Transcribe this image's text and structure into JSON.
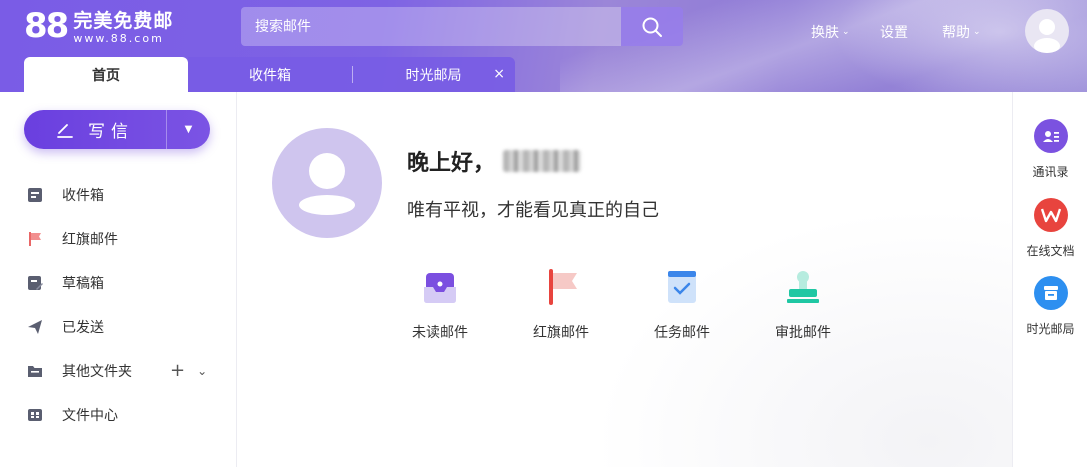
{
  "brand": {
    "logo_number": "88",
    "name": "完美免费邮",
    "url": "www.88.com"
  },
  "search": {
    "placeholder": "搜索邮件"
  },
  "header_nav": {
    "skin_label": "换肤",
    "settings_label": "设置",
    "help_label": "帮助"
  },
  "tabs": [
    {
      "label": "首页",
      "active": true
    },
    {
      "label": "收件箱",
      "active": false
    },
    {
      "label": "时光邮局",
      "active": false,
      "closable": true,
      "close_symbol": "×"
    }
  ],
  "sidebar": {
    "compose_label": "写信",
    "items": [
      {
        "label": "收件箱",
        "icon": "inbox-icon"
      },
      {
        "label": "红旗邮件",
        "icon": "red-flag-icon"
      },
      {
        "label": "草稿箱",
        "icon": "draft-icon"
      },
      {
        "label": "已发送",
        "icon": "send-icon"
      },
      {
        "label": "其他文件夹",
        "icon": "folder-icon"
      },
      {
        "label": "文件中心",
        "icon": "file-center-icon"
      }
    ],
    "folder_add_symbol": "+"
  },
  "main": {
    "greeting": "晚上好，",
    "motto": "唯有平视，才能看见真正的自己",
    "quick_actions": [
      {
        "label": "未读邮件",
        "icon": "unread-mail-icon"
      },
      {
        "label": "红旗邮件",
        "icon": "red-flag-mail-icon"
      },
      {
        "label": "任务邮件",
        "icon": "task-mail-icon"
      },
      {
        "label": "审批邮件",
        "icon": "approval-mail-icon"
      }
    ]
  },
  "right_bar": [
    {
      "label": "通讯录",
      "icon": "contacts-icon",
      "color": "#7b52e0"
    },
    {
      "label": "在线文档",
      "icon": "wps-docs-icon",
      "color": "#e8443e"
    },
    {
      "label": "时光邮局",
      "icon": "time-post-icon",
      "color": "#2d8ff0"
    }
  ],
  "colors": {
    "brand_purple": "#7b54e4",
    "header_gradient_start": "#7a5ce6"
  }
}
